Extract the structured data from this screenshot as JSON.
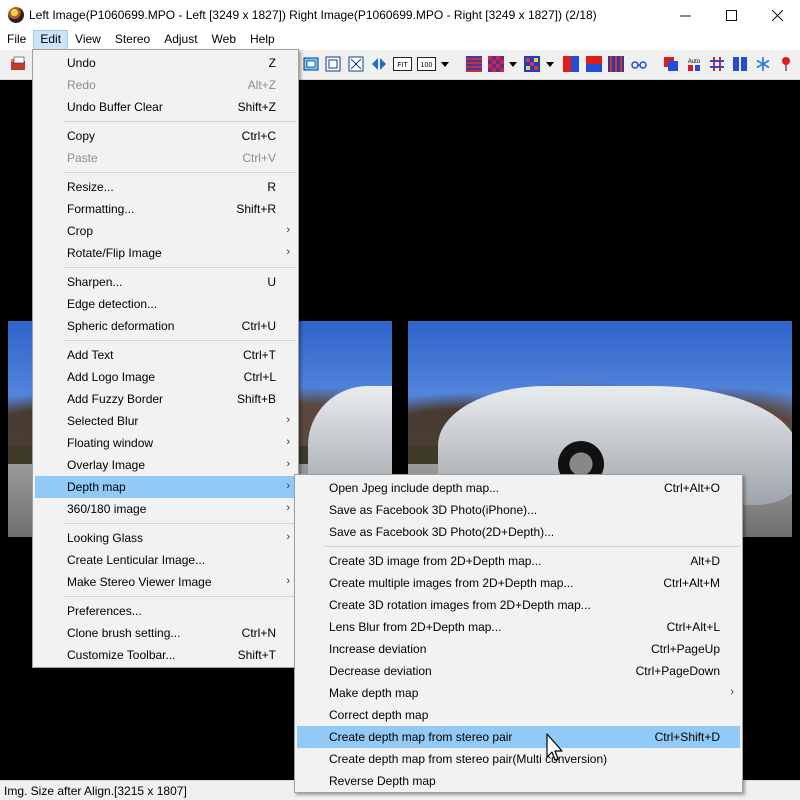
{
  "window": {
    "title": "Left Image(P1060699.MPO - Left [3249 x 1827]) Right Image(P1060699.MPO - Right [3249 x 1827])  (2/18)",
    "controls": {
      "minimize": "—",
      "maximize": "☐",
      "close": "✕"
    }
  },
  "menubar": [
    {
      "label": "File"
    },
    {
      "label": "Edit"
    },
    {
      "label": "View"
    },
    {
      "label": "Stereo"
    },
    {
      "label": "Adjust"
    },
    {
      "label": "Web"
    },
    {
      "label": "Help"
    }
  ],
  "edit_menu": [
    {
      "label": "Undo",
      "shortcut": "Z"
    },
    {
      "label": "Redo",
      "shortcut": "Alt+Z"
    },
    {
      "label": "Undo Buffer Clear",
      "shortcut": "Shift+Z"
    },
    {
      "label": "Copy",
      "shortcut": "Ctrl+C"
    },
    {
      "label": "Paste",
      "shortcut": "Ctrl+V"
    },
    {
      "label": "Resize...",
      "shortcut": "R"
    },
    {
      "label": "Formatting...",
      "shortcut": "Shift+R"
    },
    {
      "label": "Crop",
      "shortcut": ""
    },
    {
      "label": "Rotate/Flip Image",
      "shortcut": ""
    },
    {
      "label": "Sharpen...",
      "shortcut": "U"
    },
    {
      "label": "Edge detection...",
      "shortcut": ""
    },
    {
      "label": "Spheric deformation",
      "shortcut": "Ctrl+U"
    },
    {
      "label": "Add Text",
      "shortcut": "Ctrl+T"
    },
    {
      "label": "Add Logo Image",
      "shortcut": "Ctrl+L"
    },
    {
      "label": "Add Fuzzy Border",
      "shortcut": "Shift+B"
    },
    {
      "label": "Selected Blur",
      "shortcut": ""
    },
    {
      "label": "Floating window",
      "shortcut": ""
    },
    {
      "label": "Overlay Image",
      "shortcut": ""
    },
    {
      "label": "Depth map",
      "shortcut": ""
    },
    {
      "label": "360/180 image",
      "shortcut": ""
    },
    {
      "label": "Looking Glass",
      "shortcut": ""
    },
    {
      "label": "Create Lenticular Image...",
      "shortcut": ""
    },
    {
      "label": "Make Stereo Viewer Image",
      "shortcut": ""
    },
    {
      "label": "Preferences...",
      "shortcut": ""
    },
    {
      "label": "Clone brush setting...",
      "shortcut": "Ctrl+N"
    },
    {
      "label": "Customize Toolbar...",
      "shortcut": "Shift+T"
    }
  ],
  "depth_menu": [
    {
      "label": "Open Jpeg include depth map...",
      "shortcut": "Ctrl+Alt+O"
    },
    {
      "label": "Save as Facebook 3D Photo(iPhone)...",
      "shortcut": ""
    },
    {
      "label": "Save as Facebook 3D Photo(2D+Depth)...",
      "shortcut": ""
    },
    {
      "label": "Create 3D image from 2D+Depth map...",
      "shortcut": "Alt+D"
    },
    {
      "label": "Create multiple images from 2D+Depth map...",
      "shortcut": "Ctrl+Alt+M"
    },
    {
      "label": "Create 3D rotation images from 2D+Depth map...",
      "shortcut": ""
    },
    {
      "label": "Lens Blur from 2D+Depth map...",
      "shortcut": "Ctrl+Alt+L"
    },
    {
      "label": "Increase deviation",
      "shortcut": "Ctrl+PageUp"
    },
    {
      "label": "Decrease deviation",
      "shortcut": "Ctrl+PageDown"
    },
    {
      "label": "Make depth map",
      "shortcut": ""
    },
    {
      "label": "Correct depth map",
      "shortcut": ""
    },
    {
      "label": "Create depth map from stereo pair",
      "shortcut": "Ctrl+Shift+D"
    },
    {
      "label": "Create depth map from stereo pair(Multi conversion)",
      "shortcut": ""
    },
    {
      "label": "Reverse Depth map",
      "shortcut": ""
    }
  ],
  "submenu_arrow": "›",
  "toolbar": {
    "icons": [
      "open-icon",
      "fit-window-icon",
      "full-window-icon",
      "cross-icon",
      "swap-icon",
      "fit-icon",
      "zoom-100-icon",
      "interlace-icon",
      "checker-icon",
      "color-anaglyph-icon",
      "red-cyan-icon",
      "blue-red-icon",
      "side-by-side-icon",
      "glasses-icon",
      "stack-icon",
      "auto-align-icon",
      "grid-icon",
      "bars-icon",
      "snowflake-icon",
      "pin-icon"
    ],
    "fit_label": "FIT",
    "zoom_label": "100",
    "auto_label": "Auto"
  },
  "status": {
    "text": "Img. Size after Align.[3215 x 1807]"
  },
  "colors": {
    "menu_highlight": "#91c9f7",
    "menubar_active": "#cce4f7",
    "canvas": "#000000"
  }
}
